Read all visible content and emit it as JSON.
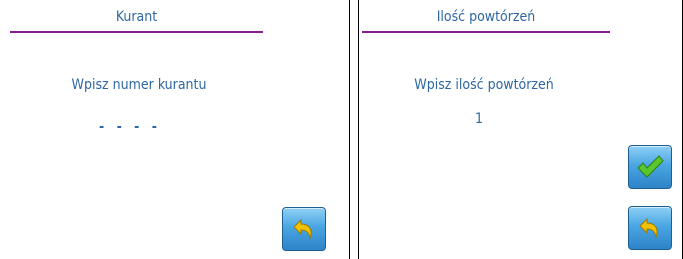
{
  "kurant_screen": {
    "title": "Kurant",
    "prompt": "Wpisz numer kurantu",
    "value_placeholder": "- - - -",
    "back_icon": "undo-arrow-icon"
  },
  "repeat_screen": {
    "title": "Ilość powtórzeń",
    "prompt": "Wpisz ilość powtórzeń",
    "value": "1",
    "confirm_icon": "checkmark-icon",
    "back_icon": "undo-arrow-icon"
  },
  "colors": {
    "text": "#2e67a3",
    "title_rule": "#8b1e8b",
    "button": "#4aa6e3",
    "arrow": "#f2c200",
    "check": "#58c72b"
  }
}
